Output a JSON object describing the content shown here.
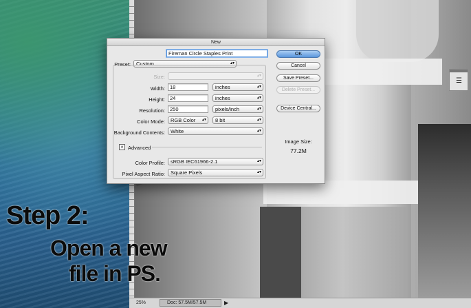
{
  "dialog": {
    "title": "New",
    "name_label": "Name:",
    "name_value": "Fireman Circle Staples Print",
    "preset_label": "Preset:",
    "preset_value": "Custom",
    "size_label": "Size:",
    "size_value": "",
    "width_label": "Width:",
    "width_value": "18",
    "width_unit": "inches",
    "height_label": "Height:",
    "height_value": "24",
    "height_unit": "inches",
    "resolution_label": "Resolution:",
    "resolution_value": "250",
    "resolution_unit": "pixels/inch",
    "color_mode_label": "Color Mode:",
    "color_mode_value": "RGB Color",
    "bit_depth_value": "8 bit",
    "background_label": "Background Contents:",
    "background_value": "White",
    "advanced_label": "Advanced",
    "color_profile_label": "Color Profile:",
    "color_profile_value": "sRGB IEC61966-2.1",
    "pixel_aspect_label": "Pixel Aspect Ratio:",
    "pixel_aspect_value": "Square Pixels",
    "ok_label": "OK",
    "cancel_label": "Cancel",
    "save_preset_label": "Save Preset...",
    "delete_preset_label": "Delete Preset...",
    "device_central_label": "Device Central...",
    "image_size_label": "Image Size:",
    "image_size_value": "77.2M",
    "accent_color": "#5a96dc"
  },
  "status_bar": {
    "zoom": "25%",
    "doc_size": "Doc: 57.5M/57.5M"
  },
  "overlay": {
    "step_title": "Step 2:",
    "step_line1": "Open a new",
    "step_line2": "file in PS."
  },
  "icons": {
    "adjustments": "adjustments-icon",
    "advanced_toggle": "disclosure-triangle-icon"
  }
}
